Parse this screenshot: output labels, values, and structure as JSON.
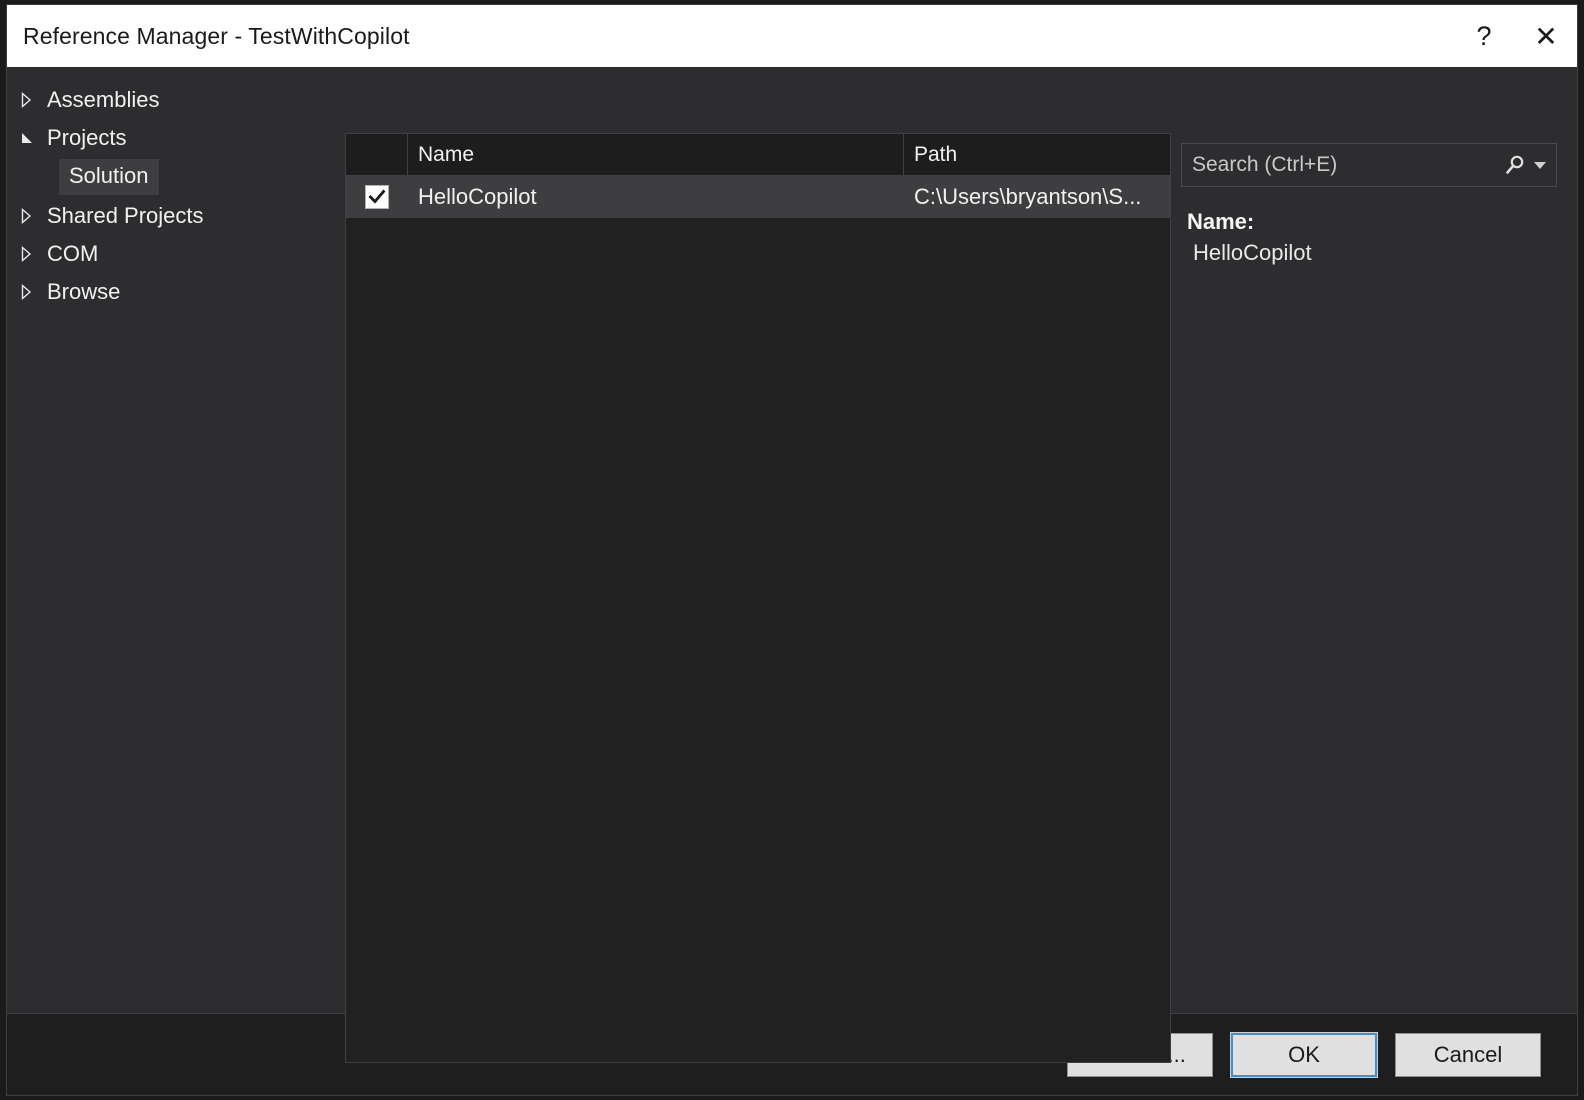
{
  "window": {
    "title": "Reference Manager - TestWithCopilot",
    "help_icon": "question-mark-icon",
    "help_label": "?",
    "close_icon": "close-icon",
    "close_label": "✕"
  },
  "sidebar": {
    "items": [
      {
        "label": "Assemblies",
        "state": "collapsed"
      },
      {
        "label": "Projects",
        "state": "expanded"
      },
      {
        "label": "Shared Projects",
        "state": "collapsed"
      },
      {
        "label": "COM",
        "state": "collapsed"
      },
      {
        "label": "Browse",
        "state": "collapsed"
      }
    ],
    "child": {
      "label": "Solution",
      "selected": true
    }
  },
  "list": {
    "columns": [
      "",
      "Name",
      "Path"
    ],
    "rows": [
      {
        "checked": true,
        "name": "HelloCopilot",
        "path": "C:\\Users\\bryantson\\S...",
        "selected": true
      }
    ]
  },
  "search": {
    "placeholder": "Search (Ctrl+E)",
    "value": "",
    "icon": "magnifier-icon",
    "dropdown_icon": "chevron-down-icon"
  },
  "details": {
    "name_key": "Name:",
    "name_value": "HelloCopilot"
  },
  "footer": {
    "browse_label": "Browse...",
    "ok_label": "OK",
    "cancel_label": "Cancel"
  },
  "colors": {
    "dialog_bg": "#2d2d30",
    "titlebar_bg": "#ffffff",
    "list_bg": "#212121",
    "footer_bg": "#1e1e1e",
    "selection_bg": "#3e3e40",
    "text": "#f1f1f1",
    "default_button_accent": "#3f8fd1"
  }
}
